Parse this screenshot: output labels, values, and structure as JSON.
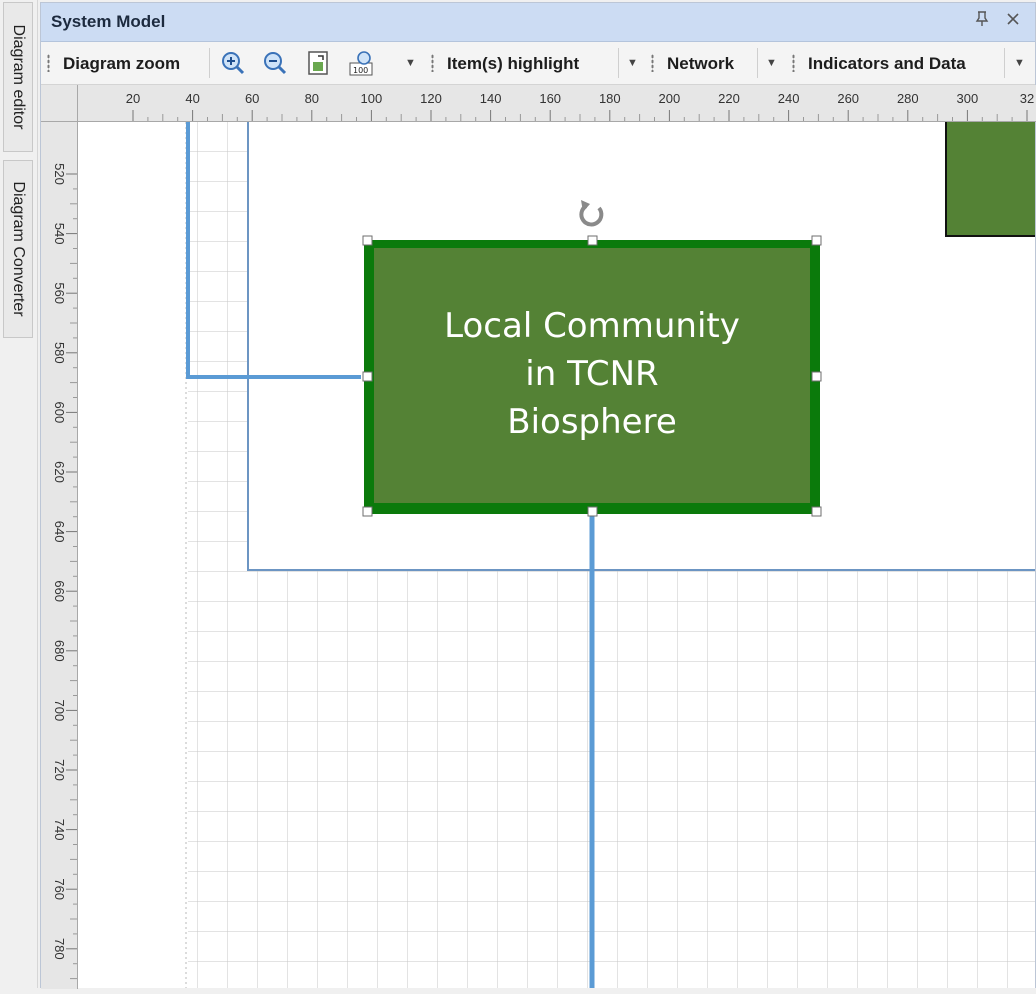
{
  "side_tabs": [
    {
      "label": "Diagram editor"
    },
    {
      "label": "Diagram Converter"
    }
  ],
  "panel": {
    "title": "System Model",
    "icons": [
      "pin-icon",
      "close-icon"
    ]
  },
  "toolbar": {
    "groups": [
      {
        "label": "Diagram zoom",
        "icons": [
          "zoom-in-icon",
          "zoom-out-icon",
          "fit-page-icon",
          "zoom-100-icon"
        ]
      },
      {
        "label": "Item(s) highlight"
      },
      {
        "label": "Network"
      },
      {
        "label": "Indicators and Data"
      }
    ]
  },
  "rulers": {
    "horizontal_ticks": [
      "20",
      "40",
      "60",
      "80",
      "100",
      "120",
      "140",
      "160",
      "180",
      "200",
      "220",
      "240",
      "260",
      "280",
      "300",
      "32"
    ],
    "vertical_ticks": [
      "520",
      "540",
      "560",
      "580",
      "600",
      "620",
      "640",
      "660",
      "680",
      "700",
      "720",
      "740",
      "760",
      "780"
    ]
  },
  "diagram": {
    "selected_node": {
      "label": "Local Community in TCNR Biosphere",
      "lines": [
        "Local Community",
        "in TCNR",
        "Biosphere"
      ],
      "fill": "#548235",
      "border": "#0b7a0b"
    },
    "other_node": {
      "fill": "#548235"
    },
    "connector_color": "#5b9bd5"
  }
}
